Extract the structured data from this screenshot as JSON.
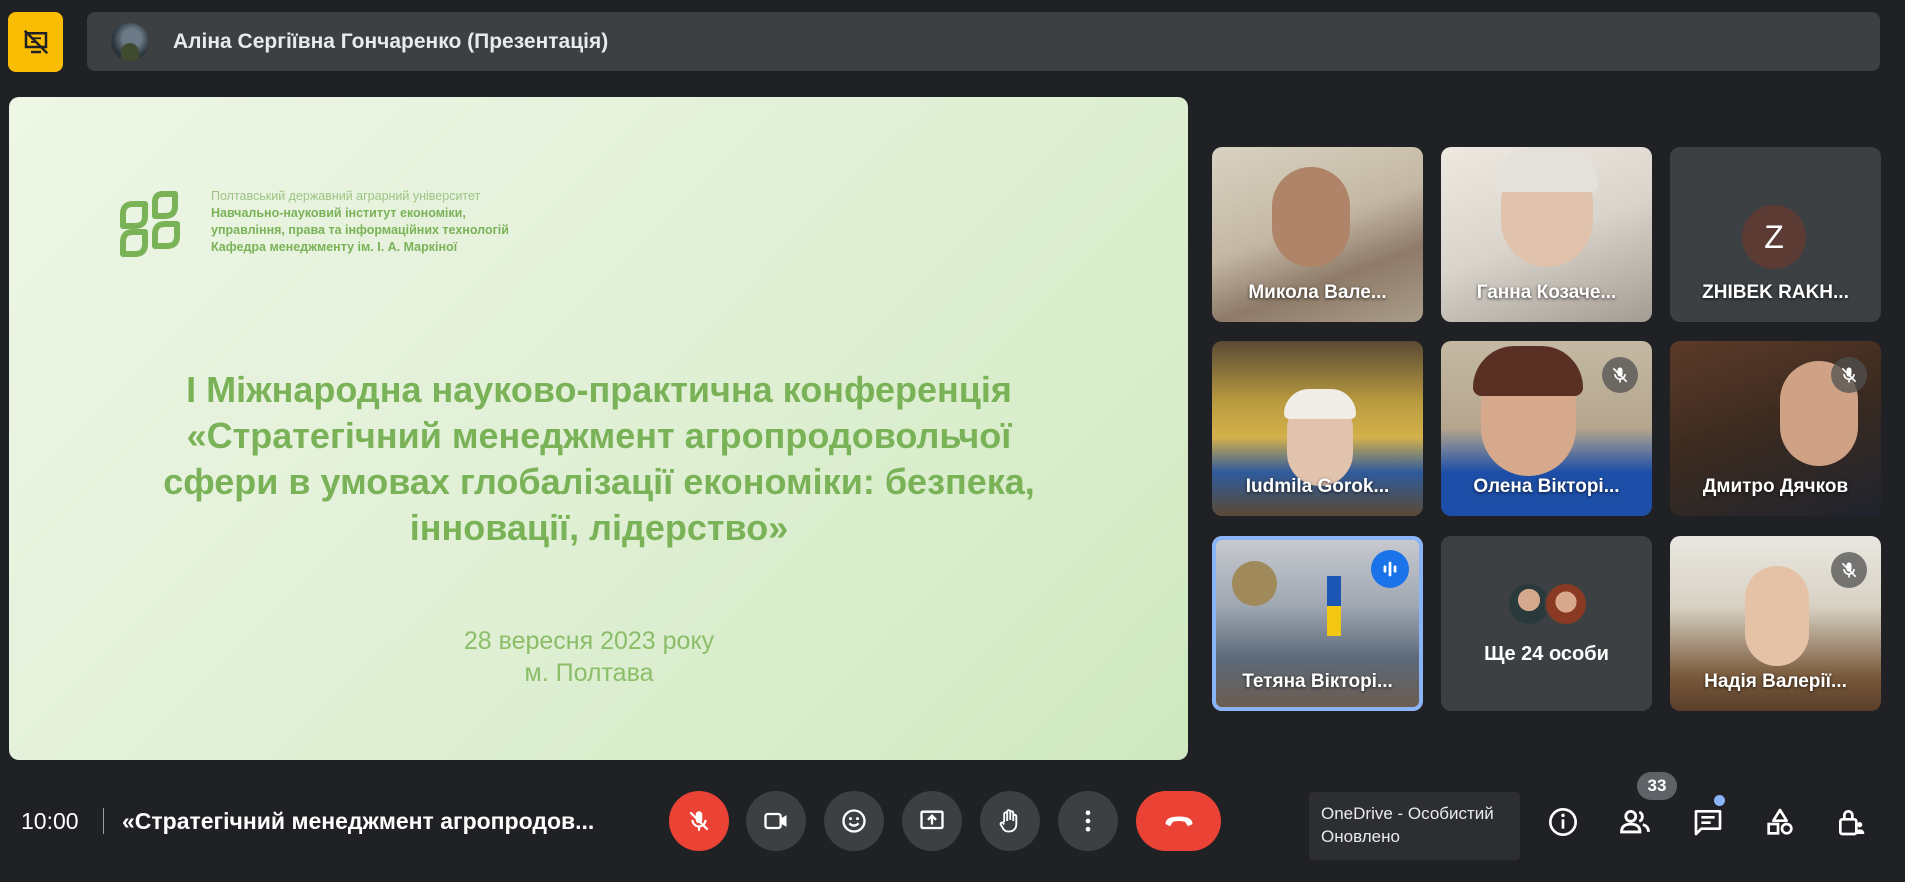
{
  "top_bar": {
    "presenter_name": "Аліна Сергіївна Гончаренко (Презентація)"
  },
  "slide": {
    "org_lines": [
      "Полтавський державний аграрний університет",
      "Навчально-науковий інститут економіки,",
      "управління, права та інформаційних технологій",
      "Кафедра менеджменту ім. І. А. Маркіної"
    ],
    "title_lines": [
      "І Міжнародна науково-практична конференція",
      "«Стратегічний менеджмент агропродовольчої",
      "сфери в умовах глобалізації економіки: безпека,",
      "інновації, лідерство»"
    ],
    "date_lines": [
      "28 вересня 2023 року",
      "м. Полтава"
    ]
  },
  "participants": [
    {
      "name": "Микола Вале...",
      "muted": false
    },
    {
      "name": "Ганна Козаче...",
      "muted": false
    },
    {
      "name": "ZHIBEK RAKH...",
      "initial": "Z",
      "muted": false
    },
    {
      "name": "Iudmila Gorok...",
      "muted": false
    },
    {
      "name": "Олена Вікторі...",
      "muted": true
    },
    {
      "name": "Дмитро Дячков",
      "muted": true
    },
    {
      "name": "Тетяна Вікторі...",
      "speaking": true
    },
    {
      "more_label": "Ще 24 особи"
    },
    {
      "name": "Надія Валерії...",
      "muted": true
    }
  ],
  "bottom_bar": {
    "time": "10:00",
    "meeting_title": "«Стратегічний менеджмент агропродов...",
    "controls": [
      "mic-off",
      "camera",
      "emoji",
      "present",
      "raise-hand",
      "more",
      "end-call"
    ],
    "participants_count": "33"
  },
  "toast": {
    "line1": "OneDrive - Особистий",
    "line2": "Оновлено"
  },
  "colors": {
    "background": "#202124",
    "surface": "#3c4043",
    "accent_yellow": "#fbbc04",
    "end_red": "#ea4335",
    "slide_green": "#7ab257",
    "speaking_blue": "#8ab4f8"
  }
}
